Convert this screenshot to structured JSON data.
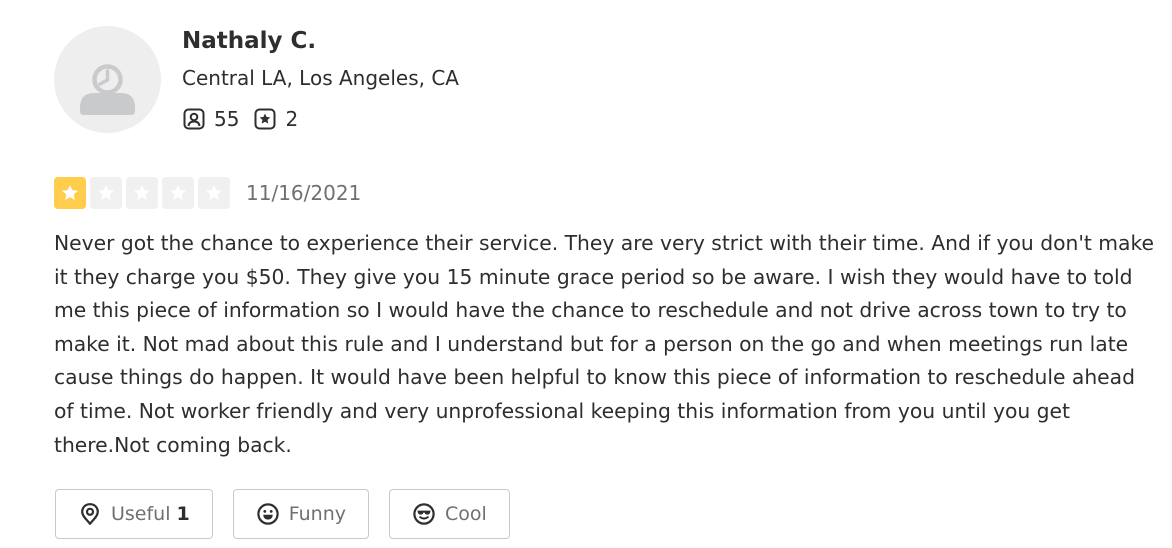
{
  "user": {
    "name": "Nathaly C.",
    "location": "Central LA, Los Angeles, CA",
    "friends_count": "55",
    "reviews_count": "2",
    "friends_icon": "friends-icon",
    "reviews_icon": "review-star-icon"
  },
  "review": {
    "rating": 1,
    "rating_max": 5,
    "date": "11/16/2021",
    "text": "Never got the chance to experience their service. They are very strict with their time. And if you don't make it they charge you $50. They give you 15 minute grace period so be aware. I wish they would have to told me this piece of information so I would have the chance to reschedule and not drive across town to try to make it. Not mad about this rule and I understand but for a person on the go and when meetings run late cause things do happen. It would have been helpful to know this piece of information to reschedule ahead of time. Not worker friendly and very unprofessional keeping this information from you until you get there.Not coming back."
  },
  "reactions": {
    "useful_label": "Useful",
    "useful_count": "1",
    "funny_label": "Funny",
    "cool_label": "Cool"
  },
  "colors": {
    "star_filled": "#ffcc4b",
    "star_empty": "#f0f0f1",
    "text_primary": "#2d2e2f",
    "text_secondary": "#6e7072",
    "button_border": "#c8c9ca",
    "avatar_bg": "#eeeeef"
  }
}
